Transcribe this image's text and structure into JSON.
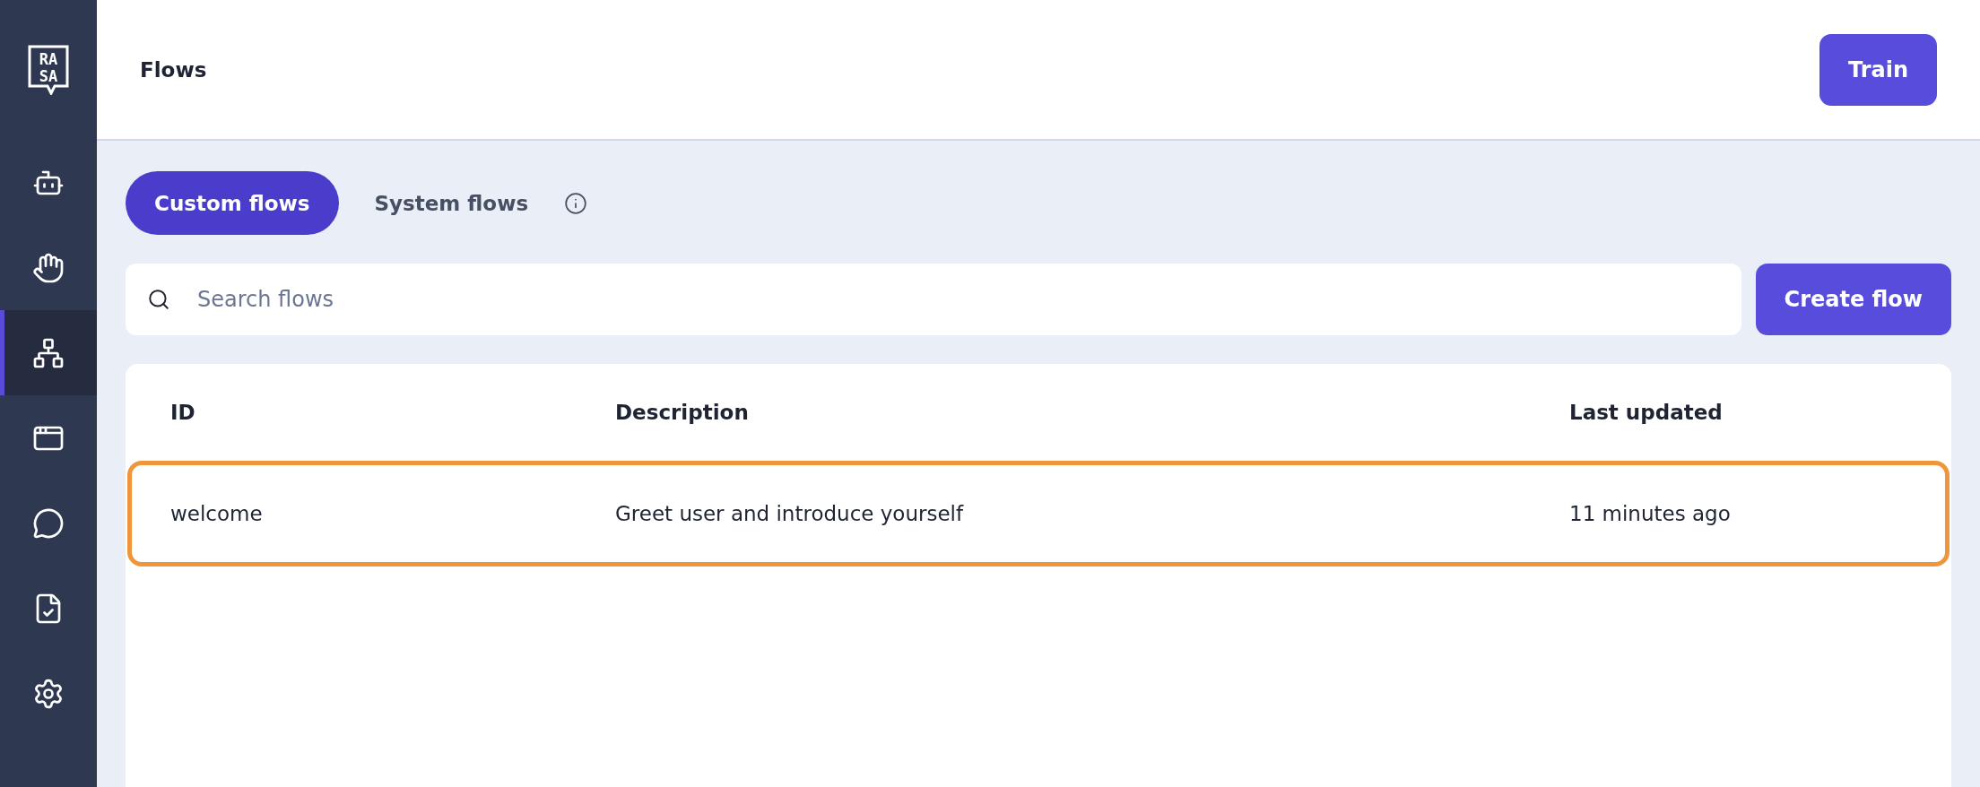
{
  "logo": {
    "lines": [
      "RA",
      "SA"
    ]
  },
  "sidebar": {
    "items": [
      {
        "selected": false
      },
      {
        "selected": false
      },
      {
        "selected": true
      },
      {
        "selected": false
      },
      {
        "selected": false
      },
      {
        "selected": false
      },
      {
        "selected": false
      }
    ]
  },
  "header": {
    "title": "Flows",
    "train_button": "Train"
  },
  "tabs": [
    {
      "label": "Custom flows",
      "selected": true
    },
    {
      "label": "System flows",
      "selected": false,
      "info": true
    }
  ],
  "search": {
    "placeholder": "Search flows"
  },
  "create_button": "Create flow",
  "table": {
    "columns": [
      "ID",
      "Description",
      "Last updated"
    ],
    "rows": [
      {
        "cells": [
          "welcome",
          "Greet user and introduce yourself",
          "11 minutes ago"
        ],
        "highlighted": true
      }
    ]
  }
}
